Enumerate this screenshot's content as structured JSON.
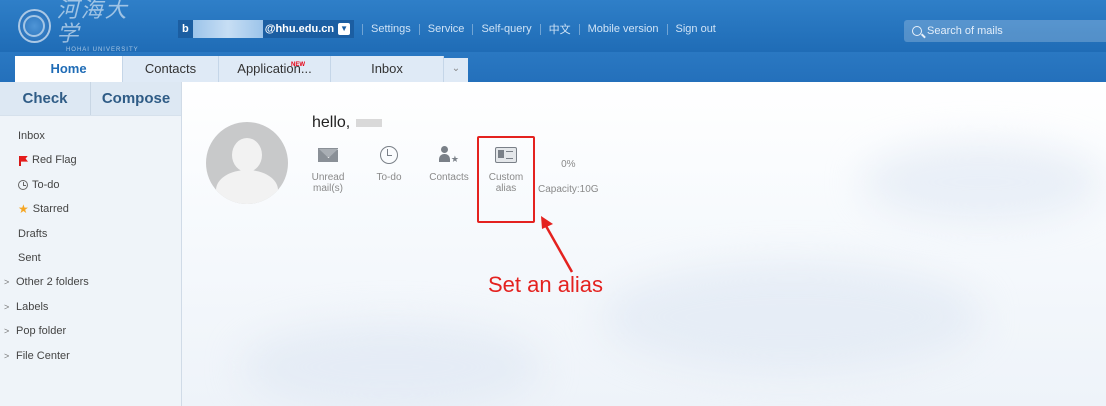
{
  "header": {
    "logo_cn": "河海大学",
    "logo_en": "HOHAI UNIVERSITY",
    "account_prefix": "b",
    "account_domain": "@hhu.edu.cn",
    "links": [
      "Settings",
      "Service",
      "Self-query",
      "中文",
      "Mobile version",
      "Sign out"
    ],
    "search_placeholder": "Search of mails"
  },
  "tabs": [
    {
      "label": "Home",
      "active": true
    },
    {
      "label": "Contacts",
      "active": false
    },
    {
      "label": "Application...",
      "active": false,
      "badge": "NEW"
    },
    {
      "label": "Inbox",
      "active": false
    }
  ],
  "sidebar": {
    "check_label": "Check",
    "compose_label": "Compose",
    "folders": [
      {
        "label": "Inbox",
        "icon": ""
      },
      {
        "label": "Red Flag",
        "icon": "red-flag-icon"
      },
      {
        "label": "To-do",
        "icon": "clock-icon"
      },
      {
        "label": "Starred",
        "icon": "star-icon"
      },
      {
        "label": "Drafts",
        "icon": ""
      },
      {
        "label": "Sent",
        "icon": ""
      },
      {
        "label": "Other 2 folders",
        "icon": "chevron-right-icon"
      },
      {
        "label": "Labels",
        "icon": "chevron-right-icon"
      },
      {
        "label": "Pop folder",
        "icon": "chevron-right-icon"
      },
      {
        "label": "File Center",
        "icon": "chevron-right-icon"
      }
    ]
  },
  "main": {
    "greeting": "hello,",
    "stats": [
      {
        "label": "Unread mail(s)",
        "icon": "mail-icon"
      },
      {
        "label": "To-do",
        "icon": "clock-icon"
      },
      {
        "label": "Contacts",
        "icon": "contacts-icon"
      },
      {
        "label": "Custom alias",
        "icon": "alias-card-icon"
      }
    ],
    "capacity_percent": "0%",
    "capacity_label": "Capacity:10G",
    "annotation": "Set an alias",
    "annotation_color": "#e4221f"
  }
}
